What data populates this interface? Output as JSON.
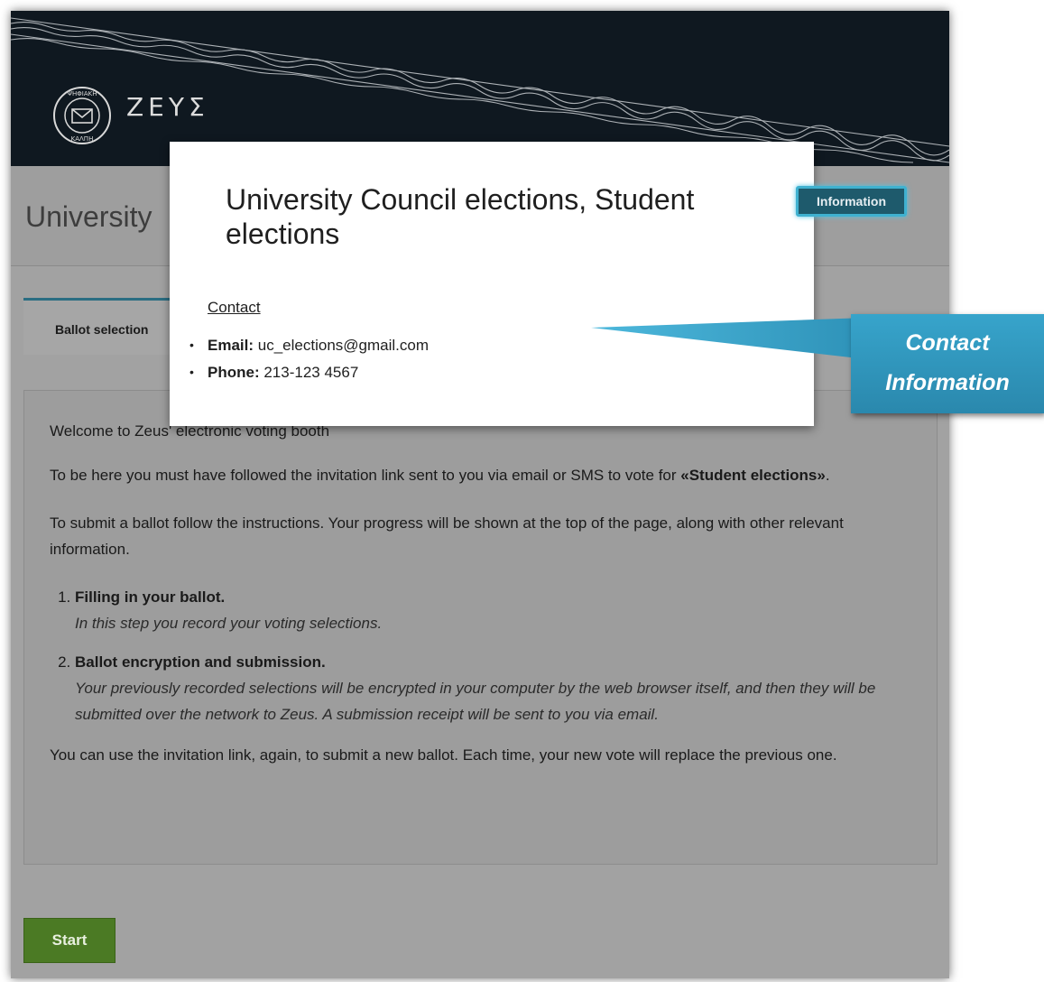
{
  "header": {
    "logo_alt": "ΨΗΦΙΑΚΗ ΚΑΛΠΗ",
    "logo_text": "ΖΕΥΣ"
  },
  "title_bar": {
    "title": "University",
    "info_button": "Information"
  },
  "tabs": [
    {
      "label": "Ballot selection"
    }
  ],
  "content": {
    "welcome": "Welcome to Zeus' electronic voting booth",
    "invite_prefix": "To be here you must have followed the invitation link sent to you via email or SMS to vote for ",
    "invite_election": "«Student elections»",
    "invite_suffix": ".",
    "instructions": "To submit a ballot follow the instructions. Your progress will be shown at the top of the page, along with other relevant information.",
    "steps": [
      {
        "title": "Filling in your ballot.",
        "desc": "In this step you record your voting selections."
      },
      {
        "title": "Ballot encryption and submission.",
        "desc": "Your previously recorded selections will be encrypted in your computer by the web browser itself, and then they will be submitted over the network to Zeus. A submission receipt will be sent to you via email."
      }
    ],
    "closing": "You can use the invitation link, again, to submit a new ballot. Each time, your new vote will replace the previous one."
  },
  "start_button": "Start",
  "modal": {
    "title": "University Council elections, Student elections",
    "contact_heading": "Contact",
    "email_label": "Email:",
    "email_value": "uc_elections@gmail.com",
    "phone_label": "Phone:",
    "phone_value": "213-123 4567"
  },
  "callout": {
    "line1": "Contact",
    "line2": "Information",
    "color": "#2d8fb5"
  },
  "colors": {
    "header_bg": "#0f1820",
    "info_button": "#1e5a6c",
    "info_glow": "#3fb1d0",
    "start_button": "#4b7a24",
    "overlay": "#a2a2a2"
  }
}
